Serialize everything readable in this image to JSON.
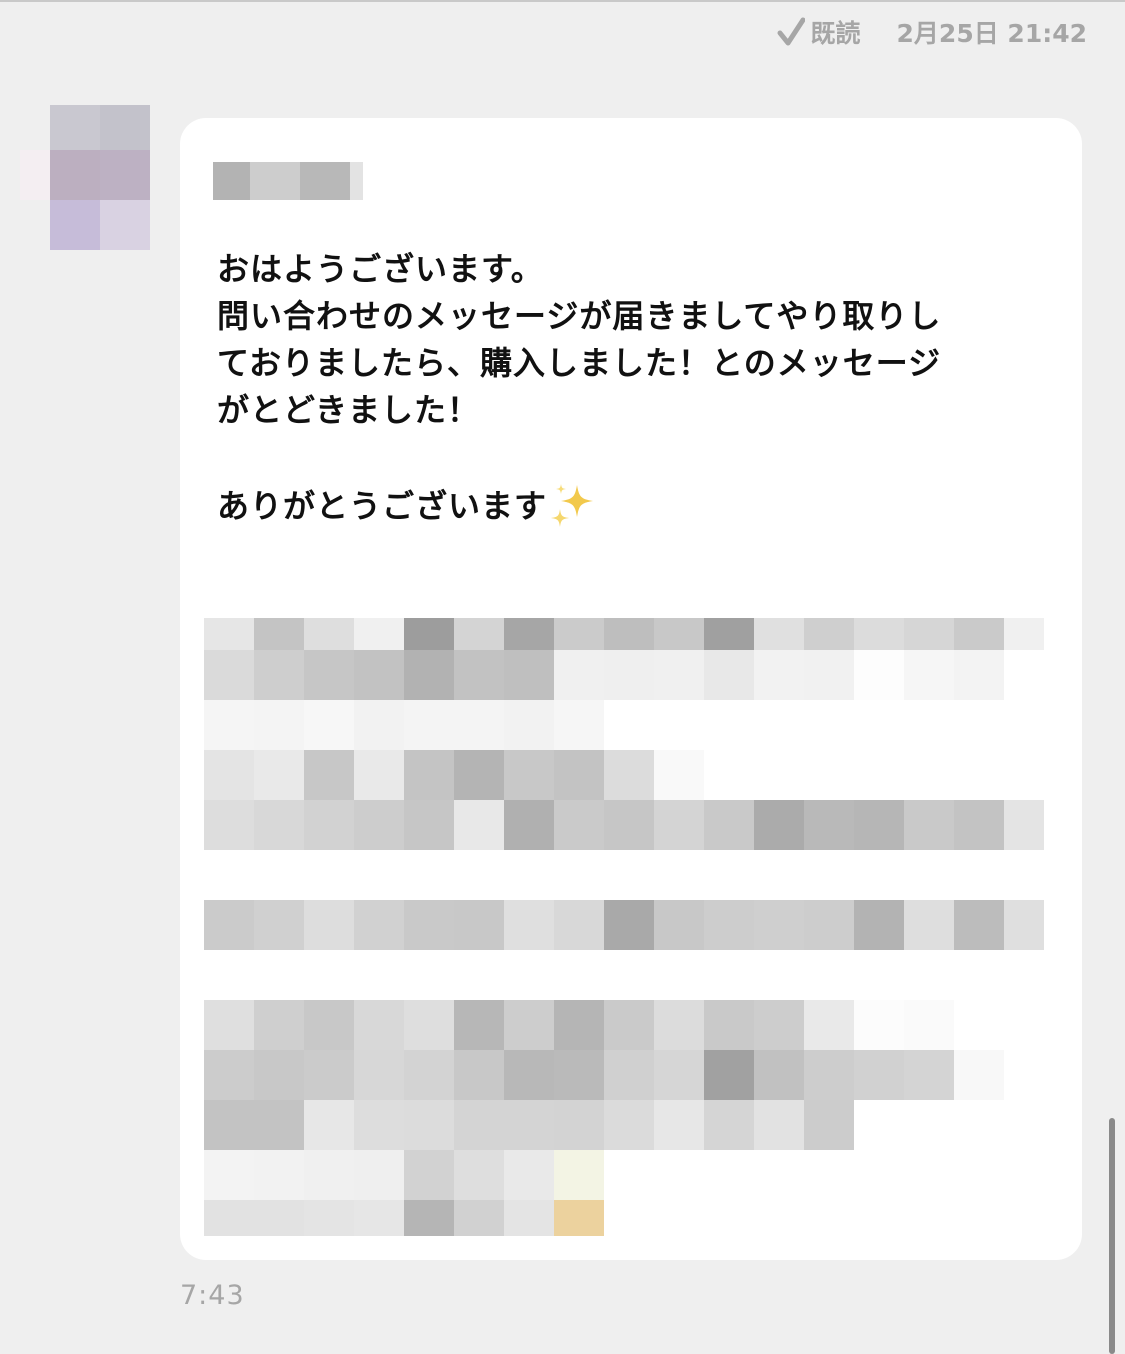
{
  "header": {
    "read_label": "既読",
    "datetime": "2月25日 21:42"
  },
  "message": {
    "lines": [
      "おはようございます。",
      "問い合わせのメッセージが届きましてやり取りし",
      "ておりましたら、購入しました！とのメッセージ",
      "がとどきました！"
    ],
    "closing": "ありがとうございます",
    "time": "7:43"
  },
  "icons": {
    "read": "check-icon",
    "emoji": "sparkles-icon"
  },
  "colors": {
    "background": "#efefef",
    "bubble": "#ffffff",
    "meta_text": "#a6a6a6",
    "message_text": "#111111"
  }
}
